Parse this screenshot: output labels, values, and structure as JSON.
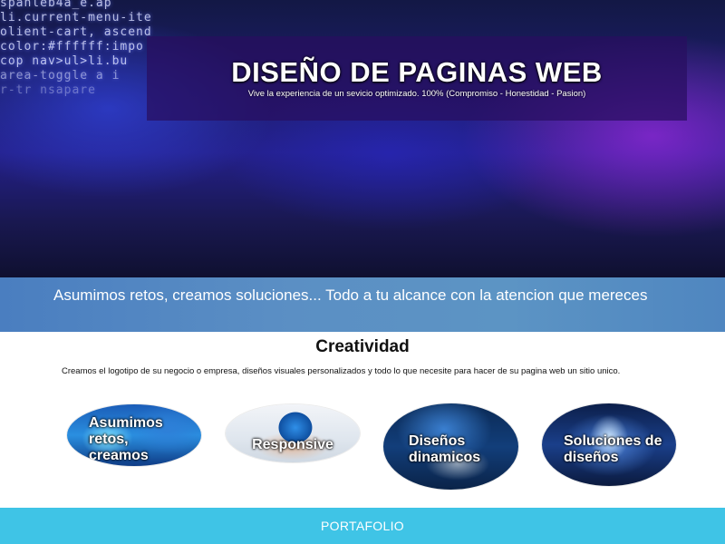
{
  "hero": {
    "title": "DISEÑO DE PAGINAS WEB",
    "subtitle": "Vive la experiencia de un sevicio optimizado. 100% (Compromiso - Honestidad - Pasion)",
    "code_lines": [
      "spanleb4a_e.ap",
      "li.current-menu-ite",
      "olient-cart, ascend",
      "color:#ffffff:impo",
      "cop nav>ul>li.bu",
      "area-toggle a i",
      "r-tr nsapare"
    ]
  },
  "banner": {
    "text": "Asumimos retos, creamos soluciones... Todo a tu alcance con la atencion que mereces"
  },
  "creatividad": {
    "title": "Creatividad",
    "description": "Creamos el logotipo de su negocio o empresa, diseños visuales personalizados y todo lo que necesite para hacer de su pagina web un sitio unico.",
    "cards": [
      {
        "label": "Asumimos retos, creamos"
      },
      {
        "label": "Responsive"
      },
      {
        "label": "Diseños dinamicos"
      },
      {
        "label": "Soluciones de diseños"
      }
    ]
  },
  "footer_bar": {
    "label": "PORTAFOLIO"
  }
}
